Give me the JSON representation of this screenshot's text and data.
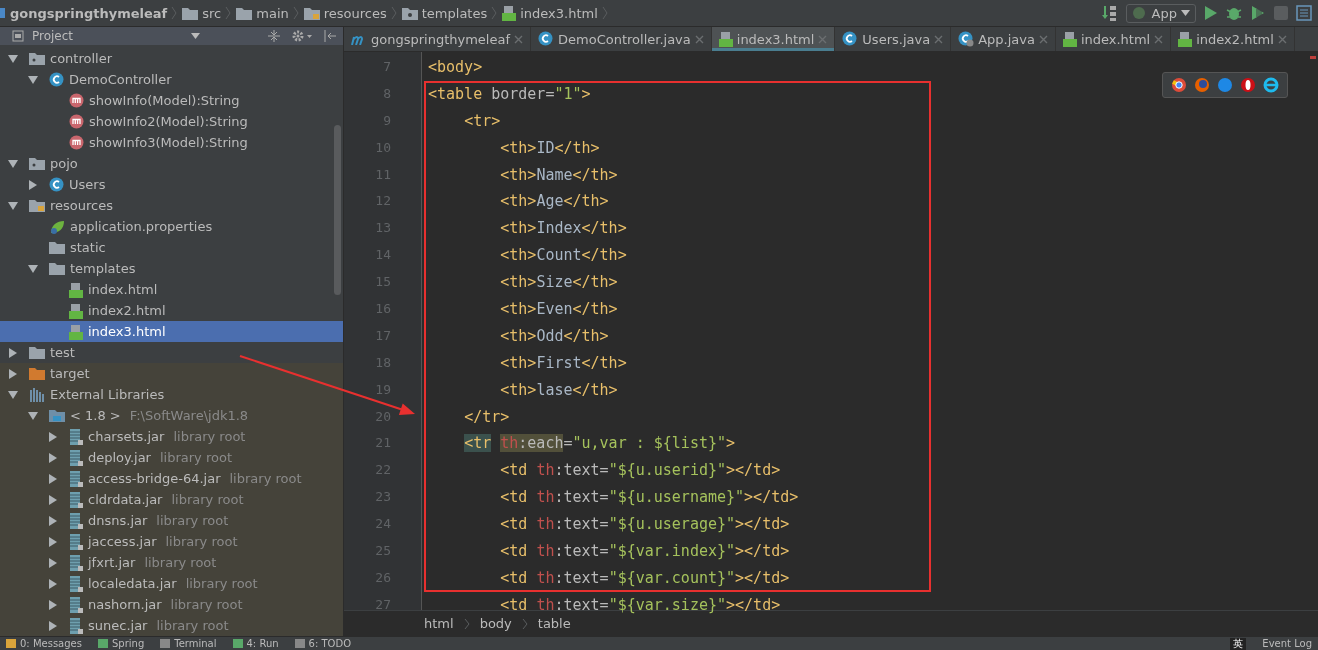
{
  "breadcrumbs": [
    {
      "label": "gongspringthymeleaf",
      "kind": "module"
    },
    {
      "label": "src",
      "kind": "folder"
    },
    {
      "label": "main",
      "kind": "folder"
    },
    {
      "label": "resources",
      "kind": "resources"
    },
    {
      "label": "templates",
      "kind": "webfolder"
    },
    {
      "label": "index3.html",
      "kind": "html"
    }
  ],
  "run_config": "App",
  "project_panel": {
    "title": "Project"
  },
  "tabs": [
    {
      "label": "gongspringthymeleaf",
      "kind": "module",
      "selected": false
    },
    {
      "label": "DemoController.java",
      "kind": "class",
      "selected": false
    },
    {
      "label": "index3.html",
      "kind": "html",
      "selected": true
    },
    {
      "label": "Users.java",
      "kind": "class",
      "selected": false
    },
    {
      "label": "App.java",
      "kind": "app",
      "selected": false
    },
    {
      "label": "index.html",
      "kind": "html",
      "selected": false
    },
    {
      "label": "index2.html",
      "kind": "html",
      "selected": false
    }
  ],
  "tree": [
    {
      "label": "controller",
      "kind": "package",
      "expanded": true,
      "selected": false,
      "children": [
        {
          "label": "DemoController",
          "kind": "class",
          "expanded": true,
          "selected": false,
          "children": [
            {
              "label": "showInfo(Model):String",
              "kind": "method",
              "selected": false
            },
            {
              "label": "showInfo2(Model):String",
              "kind": "method",
              "selected": false
            },
            {
              "label": "showInfo3(Model):String",
              "kind": "method",
              "selected": false
            }
          ]
        }
      ]
    },
    {
      "label": "pojo",
      "kind": "package",
      "expanded": true,
      "selected": false,
      "children": [
        {
          "label": "Users",
          "kind": "class",
          "expanded": false,
          "selected": false
        }
      ]
    },
    {
      "label": "resources",
      "kind": "resources",
      "expanded": true,
      "selected": false,
      "children": [
        {
          "label": "application.properties",
          "kind": "properties",
          "selected": false
        },
        {
          "label": "static",
          "kind": "folder",
          "selected": false
        },
        {
          "label": "templates",
          "kind": "folder",
          "expanded": true,
          "selected": false,
          "children": [
            {
              "label": "index.html",
              "kind": "html",
              "selected": false
            },
            {
              "label": "index2.html",
              "kind": "html",
              "selected": false
            },
            {
              "label": "index3.html",
              "kind": "html",
              "selected": true
            }
          ]
        }
      ]
    },
    {
      "label": "test",
      "kind": "folder",
      "expanded": false,
      "selected": false
    },
    {
      "label": "target",
      "kind": "excluded",
      "expanded": false,
      "selected": false
    },
    {
      "label": "External Libraries",
      "kind": "library",
      "expanded": true,
      "selected": false,
      "children": [
        {
          "label": "< 1.8 >",
          "detail": "F:\\SoftWare\\jdk1.8",
          "kind": "sdk",
          "expanded": true,
          "selected": false,
          "children": [
            {
              "label": "charsets.jar",
              "detail": "library root",
              "kind": "jar",
              "expanded": false,
              "selected": false
            },
            {
              "label": "deploy.jar",
              "detail": "library root",
              "kind": "jar",
              "expanded": false,
              "selected": false
            },
            {
              "label": "access-bridge-64.jar",
              "detail": "library root",
              "kind": "jar",
              "expanded": false,
              "selected": false
            },
            {
              "label": "cldrdata.jar",
              "detail": "library root",
              "kind": "jar",
              "expanded": false,
              "selected": false
            },
            {
              "label": "dnsns.jar",
              "detail": "library root",
              "kind": "jar",
              "expanded": false,
              "selected": false
            },
            {
              "label": "jaccess.jar",
              "detail": "library root",
              "kind": "jar",
              "expanded": false,
              "selected": false
            },
            {
              "label": "jfxrt.jar",
              "detail": "library root",
              "kind": "jar",
              "expanded": false,
              "selected": false
            },
            {
              "label": "localedata.jar",
              "detail": "library root",
              "kind": "jar",
              "expanded": false,
              "selected": false
            },
            {
              "label": "nashorn.jar",
              "detail": "library root",
              "kind": "jar",
              "expanded": false,
              "selected": false
            },
            {
              "label": "sunec.jar",
              "detail": "library root",
              "kind": "jar",
              "expanded": false,
              "selected": false
            }
          ]
        }
      ]
    }
  ],
  "code_lines": [
    {
      "number": "7",
      "tokens": [
        {
          "kind": "tag",
          "text": "<body>"
        }
      ]
    },
    {
      "number": "8",
      "tokens": [
        {
          "kind": "tag",
          "text": "<table"
        },
        {
          "kind": "attr",
          "text": " border"
        },
        {
          "kind": "attr",
          "text": "="
        },
        {
          "kind": "string",
          "text": "\"1\""
        },
        {
          "kind": "tag",
          "text": ">"
        }
      ]
    },
    {
      "number": "9",
      "tokens": [
        {
          "kind": "tag",
          "text": "    <tr>"
        }
      ]
    },
    {
      "number": "10",
      "tokens": [
        {
          "kind": "tag",
          "text": "        <th>"
        },
        {
          "kind": "text",
          "text": "ID"
        },
        {
          "kind": "tag",
          "text": "</th>"
        }
      ]
    },
    {
      "number": "11",
      "tokens": [
        {
          "kind": "tag",
          "text": "        <th>"
        },
        {
          "kind": "text",
          "text": "Name"
        },
        {
          "kind": "tag",
          "text": "</th>"
        }
      ]
    },
    {
      "number": "12",
      "tokens": [
        {
          "kind": "tag",
          "text": "        <th>"
        },
        {
          "kind": "text",
          "text": "Age"
        },
        {
          "kind": "tag",
          "text": "</th>"
        }
      ]
    },
    {
      "number": "13",
      "tokens": [
        {
          "kind": "tag",
          "text": "        <th>"
        },
        {
          "kind": "text",
          "text": "Index"
        },
        {
          "kind": "tag",
          "text": "</th>"
        }
      ]
    },
    {
      "number": "14",
      "tokens": [
        {
          "kind": "tag",
          "text": "        <th>"
        },
        {
          "kind": "text",
          "text": "Count"
        },
        {
          "kind": "tag",
          "text": "</th>"
        }
      ]
    },
    {
      "number": "15",
      "tokens": [
        {
          "kind": "tag",
          "text": "        <th>"
        },
        {
          "kind": "text",
          "text": "Size"
        },
        {
          "kind": "tag",
          "text": "</th>"
        }
      ]
    },
    {
      "number": "16",
      "tokens": [
        {
          "kind": "tag",
          "text": "        <th>"
        },
        {
          "kind": "text",
          "text": "Even"
        },
        {
          "kind": "tag",
          "text": "</th>"
        }
      ]
    },
    {
      "number": "17",
      "tokens": [
        {
          "kind": "tag",
          "text": "        <th>"
        },
        {
          "kind": "text",
          "text": "Odd"
        },
        {
          "kind": "tag",
          "text": "</th>"
        }
      ]
    },
    {
      "number": "18",
      "tokens": [
        {
          "kind": "tag",
          "text": "        <th>"
        },
        {
          "kind": "text",
          "text": "First"
        },
        {
          "kind": "tag",
          "text": "</th>"
        }
      ]
    },
    {
      "number": "19",
      "tokens": [
        {
          "kind": "tag",
          "text": "        <th>"
        },
        {
          "kind": "text",
          "text": "lase"
        },
        {
          "kind": "tag",
          "text": "</th>"
        }
      ]
    },
    {
      "number": "20",
      "tokens": [
        {
          "kind": "tag",
          "text": "    </tr>"
        }
      ]
    },
    {
      "number": "21",
      "tokens": [
        {
          "kind": "tag-match",
          "text": "    <tr"
        },
        {
          "kind": "ns-hl",
          "text": " th"
        },
        {
          "kind": "attr-hl",
          "text": ":each"
        },
        {
          "kind": "attr",
          "text": "="
        },
        {
          "kind": "string",
          "text": "\"u,var : ${list}\""
        },
        {
          "kind": "tag",
          "text": ">"
        }
      ]
    },
    {
      "number": "22",
      "tokens": [
        {
          "kind": "tag",
          "text": "        <td"
        },
        {
          "kind": "ns",
          "text": " th"
        },
        {
          "kind": "attr",
          "text": ":text="
        },
        {
          "kind": "string",
          "text": "\"${u.userid}\""
        },
        {
          "kind": "tag",
          "text": "></td>"
        }
      ]
    },
    {
      "number": "23",
      "tokens": [
        {
          "kind": "tag",
          "text": "        <td"
        },
        {
          "kind": "ns",
          "text": " th"
        },
        {
          "kind": "attr",
          "text": ":text="
        },
        {
          "kind": "string",
          "text": "\"${u.username}\""
        },
        {
          "kind": "tag",
          "text": "></td>"
        }
      ]
    },
    {
      "number": "24",
      "tokens": [
        {
          "kind": "tag",
          "text": "        <td"
        },
        {
          "kind": "ns",
          "text": " th"
        },
        {
          "kind": "attr",
          "text": ":text="
        },
        {
          "kind": "string",
          "text": "\"${u.userage}\""
        },
        {
          "kind": "tag",
          "text": "></td>"
        }
      ]
    },
    {
      "number": "25",
      "tokens": [
        {
          "kind": "tag",
          "text": "        <td"
        },
        {
          "kind": "ns",
          "text": " th"
        },
        {
          "kind": "attr",
          "text": ":text="
        },
        {
          "kind": "string",
          "text": "\"${var.index}\""
        },
        {
          "kind": "tag",
          "text": "></td>"
        }
      ]
    },
    {
      "number": "26",
      "tokens": [
        {
          "kind": "tag",
          "text": "        <td"
        },
        {
          "kind": "ns",
          "text": " th"
        },
        {
          "kind": "attr",
          "text": ":text="
        },
        {
          "kind": "string",
          "text": "\"${var.count}\""
        },
        {
          "kind": "tag",
          "text": "></td>"
        }
      ]
    },
    {
      "number": "27",
      "tokens": [
        {
          "kind": "tag",
          "text": "        <td"
        },
        {
          "kind": "ns",
          "text": " th"
        },
        {
          "kind": "attr",
          "text": ":text="
        },
        {
          "kind": "string",
          "text": "\"${var.size}\""
        },
        {
          "kind": "tag",
          "text": "></td>"
        }
      ]
    }
  ],
  "editor_breadcrumbs": [
    "html",
    "body",
    "table"
  ],
  "tool_windows": [
    {
      "label": "0: Messages",
      "kind": "messages"
    },
    {
      "label": "Spring",
      "kind": "spring"
    },
    {
      "label": "Terminal",
      "kind": "terminal"
    },
    {
      "label": "4: Run",
      "kind": "run"
    },
    {
      "label": "6: TODO",
      "kind": "todo"
    }
  ],
  "ime_indicator": "英",
  "event_log": "Event Log"
}
